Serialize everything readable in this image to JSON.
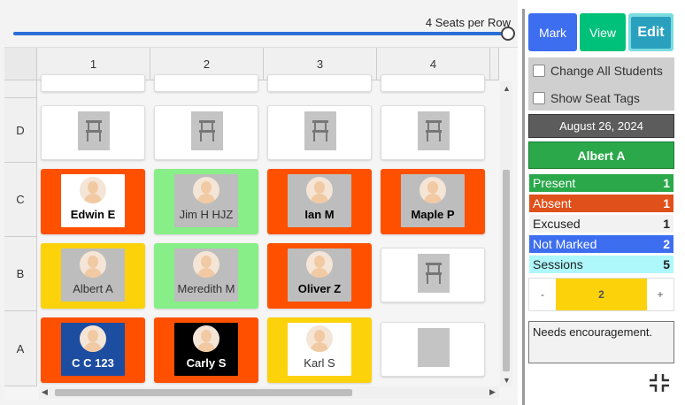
{
  "seating": {
    "seats_per_row_label": "4 Seats per Row",
    "columns": [
      "1",
      "2",
      "3",
      "4"
    ],
    "rows": [
      "D",
      "C",
      "B",
      "A"
    ],
    "seats": [
      {
        "row": "C",
        "col": 1,
        "name": "Edwin E",
        "bg": "#ff5000",
        "card": "#ffffff",
        "text": "#000000",
        "bold": true
      },
      {
        "row": "C",
        "col": 2,
        "name": "Jim H HJZ",
        "bg": "#88ee88",
        "card": "#bdbdbd",
        "text": "#333333",
        "bold": false
      },
      {
        "row": "C",
        "col": 3,
        "name": "Ian M",
        "bg": "#ff5000",
        "card": "#bdbdbd",
        "text": "#000000",
        "bold": true
      },
      {
        "row": "C",
        "col": 4,
        "name": "Maple P",
        "bg": "#ff5000",
        "card": "#bdbdbd",
        "text": "#000000",
        "bold": true
      },
      {
        "row": "B",
        "col": 1,
        "name": "Albert A",
        "bg": "#fcd20a",
        "card": "#bdbdbd",
        "text": "#333333",
        "bold": false
      },
      {
        "row": "B",
        "col": 2,
        "name": "Meredith M",
        "bg": "#88ee88",
        "card": "#bdbdbd",
        "text": "#333333",
        "bold": false
      },
      {
        "row": "B",
        "col": 3,
        "name": "Oliver Z",
        "bg": "#ff5000",
        "card": "#bdbdbd",
        "text": "#000000",
        "bold": true
      },
      {
        "row": "A",
        "col": 1,
        "name": "C C 123",
        "bg": "#ff5000",
        "card": "#1c4da1",
        "text": "#ffffff",
        "bold": true
      },
      {
        "row": "A",
        "col": 2,
        "name": "Carly S",
        "bg": "#ff5000",
        "card": "#000000",
        "text": "#ffffff",
        "bold": true
      },
      {
        "row": "A",
        "col": 3,
        "name": "Karl S",
        "bg": "#fcd20a",
        "card": "#ffffff",
        "text": "#333333",
        "bold": false
      }
    ]
  },
  "mode_buttons": {
    "mark": "Mark",
    "view": "View",
    "edit": "Edit"
  },
  "options": {
    "change_all": "Change All Students",
    "show_seat_tags": "Show Seat Tags"
  },
  "date": "August 26, 2024",
  "selected_student": "Albert A",
  "stats": [
    {
      "label": "Present",
      "count": "1",
      "bg": "#2aa84a",
      "color": "#ffffff"
    },
    {
      "label": "Absent",
      "count": "1",
      "bg": "#e0501a",
      "color": "#ffffff"
    },
    {
      "label": "Excused",
      "count": "1",
      "bg": "#f2f2f2",
      "color": "#222222"
    },
    {
      "label": "Not Marked",
      "count": "2",
      "bg": "#3d6ef0",
      "color": "#ffffff"
    },
    {
      "label": "Sessions",
      "count": "5",
      "bg": "#aef7fb",
      "color": "#222222"
    }
  ],
  "stepper": {
    "minus": "-",
    "value": "2",
    "plus": "+"
  },
  "notes": "Needs encouragement.",
  "icons": {
    "chair": "chair-icon",
    "collapse": "collapse-icon"
  }
}
